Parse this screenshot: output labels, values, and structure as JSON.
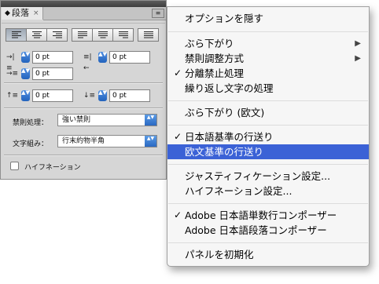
{
  "panel": {
    "tab_updown": "◆",
    "tab_label": "段落",
    "tab_close": "×",
    "menu_button": "≡",
    "alignment_buttons": [
      {
        "name": "align-left",
        "selected": true
      },
      {
        "name": "align-center",
        "selected": false
      },
      {
        "name": "align-right",
        "selected": false
      },
      {
        "name": "justify-last-left",
        "selected": false
      },
      {
        "name": "justify-last-center",
        "selected": false
      },
      {
        "name": "justify-last-right",
        "selected": false
      },
      {
        "name": "justify-all",
        "selected": false
      }
    ],
    "left_indent": {
      "icon": "→|≡",
      "value": "0 pt"
    },
    "right_indent": {
      "icon": "≡|←",
      "value": "0 pt"
    },
    "first_line_indent": {
      "icon": "→≡",
      "value": "0 pt"
    },
    "space_before": {
      "icon": "↑≡",
      "value": "0 pt"
    },
    "space_after": {
      "icon": "↓≡",
      "value": "0 pt"
    },
    "spinner_glyph": "▲▼",
    "kinsoku_label": "禁則処理：",
    "kinsoku_value": "強い禁則",
    "mojikumi_label": "文字組み：",
    "mojikumi_value": "行末約物半角",
    "select_arrows": "▲▼",
    "hyphenation_label": "ハイフネーション",
    "hyphenation_checked": false
  },
  "menu": {
    "accent_color": "#3b62d6",
    "items": [
      {
        "label": "オプションを隠す",
        "checked": false,
        "submenu": false
      },
      {
        "label": "ぶら下がり",
        "checked": false,
        "submenu": true
      },
      {
        "label": "禁則調整方式",
        "checked": false,
        "submenu": true
      },
      {
        "label": "分離禁止処理",
        "checked": true,
        "submenu": false
      },
      {
        "label": "繰り返し文字の処理",
        "checked": false,
        "submenu": false
      },
      {
        "label": "ぶら下がり (欧文)",
        "checked": false,
        "submenu": false
      },
      {
        "label": "日本語基準の行送り",
        "checked": true,
        "submenu": false
      },
      {
        "label": "欧文基準の行送り",
        "checked": false,
        "submenu": false,
        "highlighted": true
      },
      {
        "label": "ジャスティフィケーション設定...",
        "checked": false,
        "submenu": false
      },
      {
        "label": "ハイフネーション設定...",
        "checked": false,
        "submenu": false
      },
      {
        "label": "Adobe 日本語単数行コンポーザー",
        "checked": true,
        "submenu": false
      },
      {
        "label": "Adobe 日本語段落コンポーザー",
        "checked": false,
        "submenu": false
      },
      {
        "label": "パネルを初期化",
        "checked": false,
        "submenu": false
      }
    ],
    "check_glyph": "✓",
    "submenu_glyph": "▶"
  }
}
